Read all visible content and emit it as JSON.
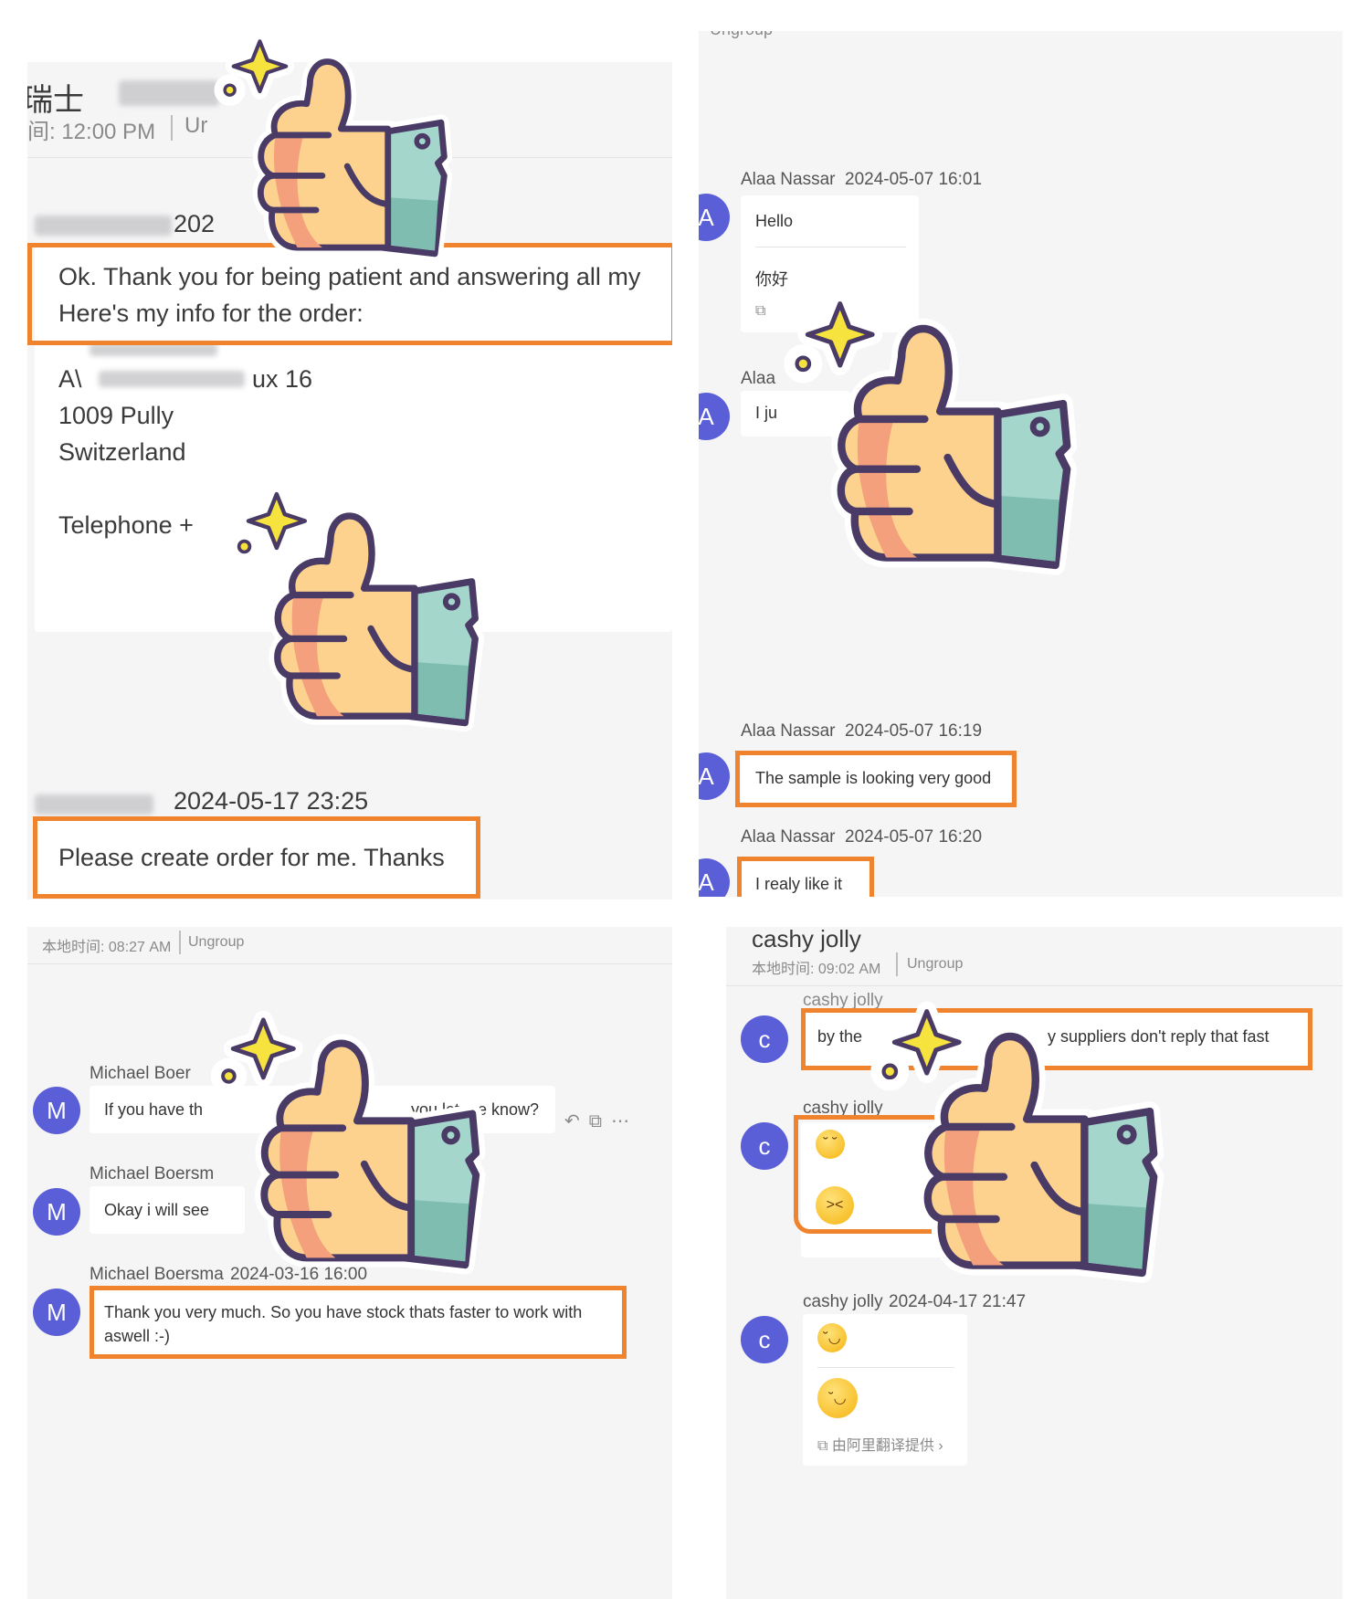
{
  "panel1": {
    "title": "瑞士",
    "localtime": "间: 12:00 PM",
    "group_fragment": "Ur",
    "msg1_time": "202",
    "msg1_line1": "Ok. Thank you for being patient and answering all my",
    "msg1_line2": "Here's my info for the order:",
    "address_line1_start": "A\\",
    "address_line1_end": "ux 16",
    "address_line2": "1009 Pully",
    "address_line3": "Switzerland",
    "telephone": "Telephone +",
    "msg2_time": "2024-05-17 23:25",
    "msg2_text": "Please create order for me. Thanks"
  },
  "panel2": {
    "header_fragment": "Ungroup",
    "msg1_sender": "Alaa Nassar",
    "msg1_time": "2024-05-07 16:01",
    "msg1_text": "Hello",
    "msg1_translation": "你好",
    "msg2_sender": "Alaa",
    "msg2_text": "I ju",
    "msg3_sender": "Alaa Nassar",
    "msg3_time": "2024-05-07 16:19",
    "msg3_text": "The sample is looking very good",
    "msg4_sender": "Alaa Nassar",
    "msg4_time": "2024-05-07 16:20",
    "msg4_text": "I realy like it",
    "avatar_letter": "A"
  },
  "panel3": {
    "localtime": "本地时间: 08:27 AM",
    "group": "Ungroup",
    "msg1_sender": "Michael Boer",
    "msg1_text_start": "If you have th",
    "msg1_text_end": "you let me know?",
    "msg2_sender": "Michael Boersm",
    "msg2_text": "Okay i will see",
    "msg3_sender": "Michael Boersma",
    "msg3_time": "2024-03-16 16:00",
    "msg3_line1": "Thank you very much. So you have stock thats faster to work with",
    "msg3_line2": "aswell :-)",
    "avatar_letter": "M"
  },
  "panel4": {
    "name": "cashy jolly",
    "localtime": "本地时间: 09:02 AM",
    "group": "Ungroup",
    "msg1_header": "cashy jolly",
    "msg1_text_start": "by the",
    "msg1_text_end": "y suppliers don't reply that fast",
    "msg2_sender": "cashy jolly",
    "msg3_sender": "cashy jolly",
    "msg3_time": "2024-04-17 21:47",
    "translate_note": "由阿里翻译提供",
    "avatar_letter": "c"
  }
}
